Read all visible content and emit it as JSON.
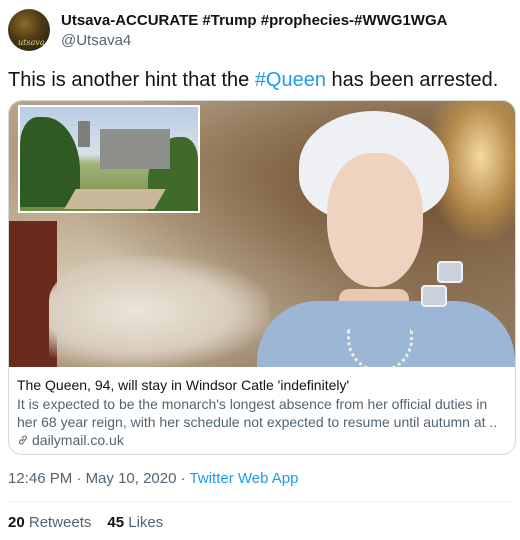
{
  "author": {
    "display_name": "Utsava-ACCURATE #Trump #prophecies-#WWG1WGA",
    "handle": "@Utsava4",
    "avatar_caption": "utsava"
  },
  "tweet": {
    "text_before": "This is another hint that the ",
    "hashtag": "#Queen",
    "text_after": " has been arrested."
  },
  "card": {
    "title": "The Queen, 94, will stay in Windsor Catle 'indefinitely'",
    "description_line1": "It is expected to be the monarch's longest absence from her official duties in",
    "description_line2": "her 68 year reign, with her schedule not expected to resume until autumn at ...",
    "domain": "dailymail.co.uk",
    "icon": "link-icon"
  },
  "meta": {
    "time": "12:46 PM",
    "separator": " · ",
    "date": "May 10, 2020",
    "separator2": " · ",
    "app": "Twitter Web App"
  },
  "stats": {
    "retweets_count": "20",
    "retweets_label": " Retweets",
    "likes_count": "45",
    "likes_label": " Likes"
  },
  "colors": {
    "link": "#1d9bf0",
    "secondary_text": "#536471",
    "border": "#cfd9de"
  }
}
